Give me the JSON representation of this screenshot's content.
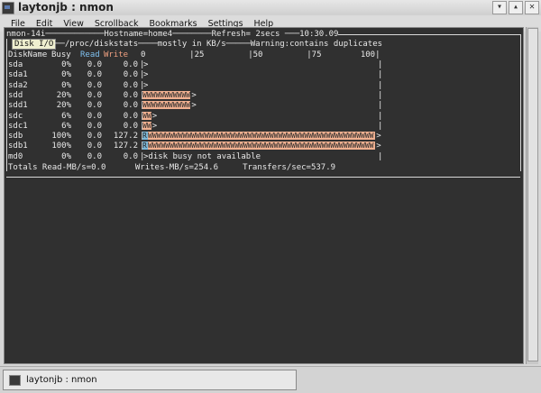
{
  "window": {
    "title": "laytonjb : nmon",
    "buttons": [
      "▾",
      "▴",
      "✕"
    ]
  },
  "menu": [
    "File",
    "Edit",
    "View",
    "Scrollback",
    "Bookmarks",
    "Settings",
    "Help"
  ],
  "nmon": {
    "header_line": "nmon-14i────────────Hostname=home4────────Refresh= 2secs ───10:30.09",
    "tab_label": "Disk I/O",
    "subheader_line": "──/proc/diskstats────mostly in KB/s─────Warning:contains duplicates",
    "col_diskname": "DiskName",
    "col_busy": "Busy",
    "col_read": "Read",
    "col_write": "Write",
    "scale": "0         |25         |50         |75        100|",
    "rows": [
      {
        "name": "sda",
        "busy": "0%",
        "read": "0.0",
        "write": "0.0",
        "suffix": ">"
      },
      {
        "name": "sda1",
        "busy": "0%",
        "read": "0.0",
        "write": "0.0",
        "suffix": ">"
      },
      {
        "name": "sda2",
        "busy": "0%",
        "read": "0.0",
        "write": "0.0",
        "suffix": ">"
      },
      {
        "name": "sdd",
        "busy": "20%",
        "read": "0.0",
        "write": "0.0",
        "suffix": ">",
        "bar": "WWWWWWWWWWW"
      },
      {
        "name": "sdd1",
        "busy": "20%",
        "read": "0.0",
        "write": "0.0",
        "suffix": ">",
        "bar": "WWWWWWWWWWW"
      },
      {
        "name": "sdc",
        "busy": "6%",
        "read": "0.0",
        "write": "0.0",
        "suffix": ">",
        "bar": "WW"
      },
      {
        "name": "sdc1",
        "busy": "6%",
        "read": "0.0",
        "write": "0.0",
        "suffix": ">",
        "bar": "WW"
      },
      {
        "name": "sdb",
        "busy": "100%",
        "read": "0.0",
        "write": "127.2",
        "suffix": ">",
        "bar": "RWWWWWWWWWWWWWWWWWWWWWWWWWWWWWWWWWWWWWWWWWWWWWWWWWWWW"
      },
      {
        "name": "sdb1",
        "busy": "100%",
        "read": "0.0",
        "write": "127.2",
        "suffix": ">",
        "bar": "RWWWWWWWWWWWWWWWWWWWWWWWWWWWWWWWWWWWWWWWWWWWWWWWWWWWW"
      },
      {
        "name": "md0",
        "busy": "0%",
        "read": "0.0",
        "write": "0.0",
        "suffix": ">disk busy not available"
      }
    ],
    "totals": "Totals Read-MB/s=0.0      Writes-MB/s=254.6     Transfers/sec=537.9"
  },
  "taskbar": {
    "task_label": "laytonjb : nmon"
  }
}
